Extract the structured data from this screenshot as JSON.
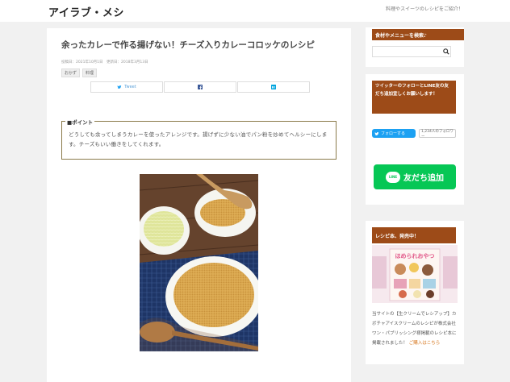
{
  "header": {
    "site_title": "アイラブ・メシ",
    "tagline": "料理やスイーツのレシピをご紹介！"
  },
  "post": {
    "title": "余ったカレーで作る揚げない！チーズ入りカレーコロッケのレシピ",
    "meta": "投稿日：2021年10月1日　更新日：2018年3月13日",
    "tags": [
      "おかず",
      "料理"
    ],
    "share": [
      {
        "label": "Tweet",
        "icon": "twitter-icon"
      },
      {
        "label": "",
        "icon": "facebook-icon"
      },
      {
        "label": "",
        "icon": "hatena-bookmark-icon"
      }
    ],
    "point_label": "■ポイント",
    "point_text": "どうしても余ってしまうカレーを使ったアレンジです。揚げずに少ない油でパン粉を炒めてヘルシーにします。チーズもいい働きをしてくれます。"
  },
  "sidebar": {
    "search": {
      "heading": "食材やメニューを検索♪",
      "placeholder": ""
    },
    "follow": {
      "heading": "ツイッターのフォローとLINE友の友だち追加宜しくお願いします！",
      "twitter_label": "フォローする",
      "twitter_count": "1,234人のフォロワー",
      "line_label": "友だち追加",
      "line_icon_text": "LINE"
    },
    "book": {
      "heading": "レシピ本、発売中！",
      "cover_title": "ほめられおやつ",
      "description": "当サイトの【生クリームでレシアップ】カボチャアイスクリームのレシピが株式会社ワン・パブリッシング様掲載のレシピ本に掲載されました！",
      "link_label": "ご購入はこちら"
    }
  },
  "colors": {
    "accent": "#9d4b18",
    "line_green": "#06c755",
    "twitter_blue": "#1da1f2"
  }
}
